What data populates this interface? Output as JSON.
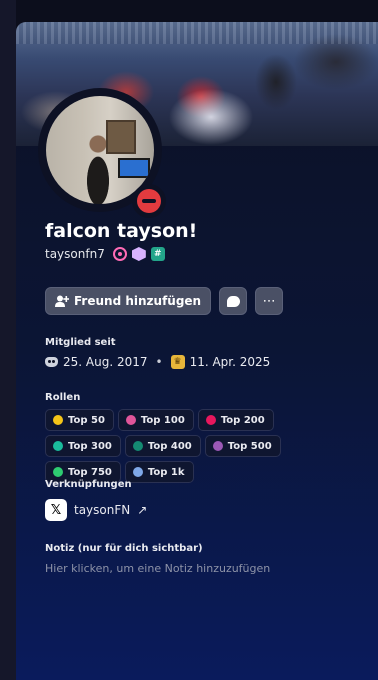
{
  "profile": {
    "display_name": "falcon tayson!",
    "username": "taysonfn7",
    "badges": [
      {
        "icon": "nitro-badge-icon",
        "color": "#ff6bb5"
      },
      {
        "icon": "hypesquad-hex-badge-icon",
        "color": "#d9b3ff"
      },
      {
        "icon": "hashtag-badge-icon",
        "color": "#23a58a"
      }
    ],
    "status": {
      "icon": "do-not-disturb-icon",
      "color": "#e23b3f"
    }
  },
  "actions": {
    "add_friend_label": "Freund hinzufügen",
    "add_friend_icon": "add-friend-icon",
    "message_icon": "message-bubble-icon",
    "more_label": "⋯"
  },
  "member_since": {
    "title": "Mitglied seit",
    "discord_date": "25. Aug. 2017",
    "separator": "•",
    "server_date": "11. Apr. 2025"
  },
  "roles": {
    "title": "Rollen",
    "items": [
      {
        "label": "Top 50",
        "color": "#f5c518"
      },
      {
        "label": "Top 100",
        "color": "#e0559a"
      },
      {
        "label": "Top 200",
        "color": "#e8175d"
      },
      {
        "label": "Top 300",
        "color": "#1abc9c"
      },
      {
        "label": "Top 400",
        "color": "#148a72"
      },
      {
        "label": "Top 500",
        "color": "#9b59b6"
      },
      {
        "label": "Top 750",
        "color": "#2ecc71"
      },
      {
        "label": "Top 1k",
        "color": "#7fa8e8"
      }
    ]
  },
  "connections": {
    "title": "Verknüpfungen",
    "items": [
      {
        "platform_icon": "x-twitter-icon",
        "logo_text": "𝕏",
        "name": "taysonFN",
        "external": "↗"
      }
    ]
  },
  "note": {
    "title": "Notiz (nur für dich sichtbar)",
    "placeholder": "Hier klicken, um eine Notiz hinzuzufügen"
  }
}
